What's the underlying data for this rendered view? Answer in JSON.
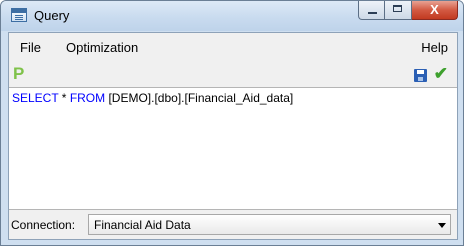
{
  "window": {
    "title": "Query",
    "icon": "query-window-icon",
    "close_glyph": "X"
  },
  "menu": {
    "items": [
      "File",
      "Optimization"
    ],
    "help": "Help"
  },
  "toolbar": {
    "p_label": "P",
    "icons": [
      "save-icon",
      "checkmark-icon"
    ],
    "check_glyph": "✔"
  },
  "editor": {
    "sql": {
      "kw1": "SELECT",
      "star": " * ",
      "kw2": "FROM",
      "table": " [DEMO].[dbo].[Financial_Aid_data]"
    }
  },
  "connection": {
    "label": "Connection:",
    "value": "Financial Aid Data"
  },
  "colors": {
    "keyword": "#0000ff",
    "p_icon": "#7fc24a",
    "check": "#3ea02e",
    "close_button": "#c23a21"
  }
}
